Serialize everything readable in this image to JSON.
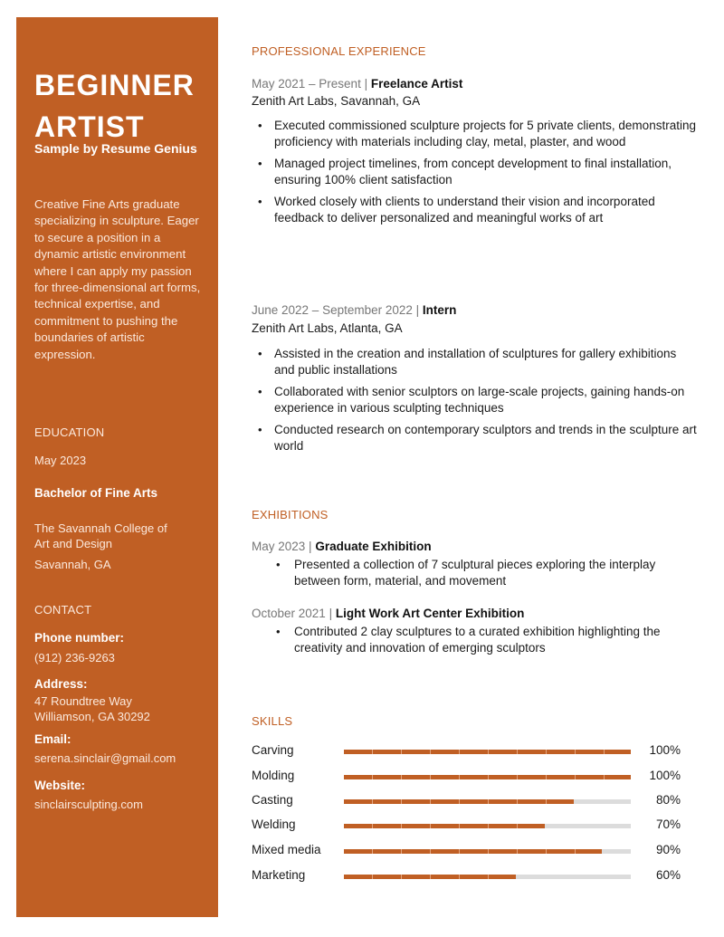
{
  "sidebar": {
    "name_line1": "BEGINNER",
    "name_line2": "ARTIST",
    "byline": "Sample by Resume Genius",
    "summary": "Creative Fine Arts graduate specializing in sculpture. Eager to secure a position in a dynamic artistic environment where I can apply my passion for three-dimensional art forms, technical expertise, and commitment to pushing the boundaries of artistic expression.",
    "education": {
      "heading": "EDUCATION",
      "date": "May 2023",
      "degree": "Bachelor of Fine Arts",
      "school_line1": "The Savannah College of",
      "school_line2": "Art and Design",
      "location": "Savannah, GA"
    },
    "contact": {
      "heading": "CONTACT",
      "phone_label": "Phone number:",
      "phone": "(912) 236-9263",
      "address_label": "Address:",
      "address_line1": "47 Roundtree Way",
      "address_line2": "Williamson, GA 30292",
      "email_label": "Email:",
      "email": "serena.sinclair@gmail.com",
      "website_label": "Website:",
      "website": "sinclairsculpting.com"
    }
  },
  "experience": {
    "heading": "PROFESSIONAL EXPERIENCE",
    "jobs": [
      {
        "date": "May 2021 – Present",
        "separator": " | ",
        "title": "Freelance Artist",
        "company": "Zenith Art Labs, Savannah, GA",
        "bullets": [
          "Executed commissioned sculpture projects for 5 private clients, demonstrating proficiency with materials including clay, metal, plaster, and wood",
          "Managed project timelines, from concept development to final installation, ensuring 100% client satisfaction",
          "Worked closely with clients to understand their vision and incorporated feedback to deliver personalized and meaningful works of art"
        ]
      },
      {
        "date": "June 2022 – September 2022",
        "separator": " | ",
        "title": "Intern",
        "company": "Zenith Art Labs, Atlanta, GA",
        "bullets": [
          "Assisted in the creation and installation of sculptures for gallery exhibitions and public installations",
          "Collaborated with senior sculptors on large-scale projects, gaining hands-on experience in various sculpting techniques",
          "Conducted research on contemporary sculptors and trends in the sculpture art world"
        ]
      }
    ]
  },
  "exhibitions": {
    "heading": "EXHIBITIONS",
    "items": [
      {
        "date": "May 2023",
        "separator": " | ",
        "title": "Graduate Exhibition",
        "bullets": [
          "Presented a collection of 7 sculptural pieces exploring the interplay between form, material, and movement"
        ]
      },
      {
        "date": "October 2021",
        "separator": " | ",
        "title": "Light Work Art Center Exhibition",
        "bullets": [
          "Contributed 2 clay sculptures to a curated exhibition highlighting the creativity and innovation of emerging sculptors"
        ]
      }
    ]
  },
  "skills": {
    "heading": "SKILLS",
    "items": [
      {
        "label": "Carving",
        "value": 100,
        "pct_label": "100%"
      },
      {
        "label": "Molding",
        "value": 100,
        "pct_label": "100%"
      },
      {
        "label": "Casting",
        "value": 80,
        "pct_label": "80%"
      },
      {
        "label": "Welding",
        "value": 70,
        "pct_label": "70%"
      },
      {
        "label": "Mixed media",
        "value": 90,
        "pct_label": "90%"
      },
      {
        "label": "Marketing",
        "value": 60,
        "pct_label": "60%"
      }
    ]
  },
  "colors": {
    "accent": "#c05f24",
    "track": "#dcdcdc",
    "date_gray": "#777777"
  }
}
